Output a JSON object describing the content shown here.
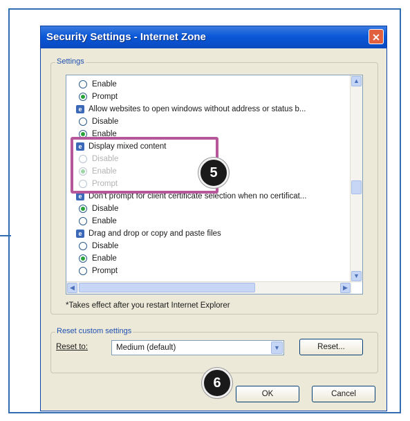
{
  "dialog": {
    "title": "Security Settings - Internet Zone",
    "close_symbol": "✕"
  },
  "settings_group": {
    "label": "Settings",
    "rows": [
      {
        "kind": "option",
        "label": "Enable",
        "checked": false,
        "disabled": false
      },
      {
        "kind": "option",
        "label": "Prompt",
        "checked": true,
        "disabled": false
      },
      {
        "kind": "category",
        "label": "Allow websites to open windows without address or status b..."
      },
      {
        "kind": "option",
        "label": "Disable",
        "checked": false,
        "disabled": false
      },
      {
        "kind": "option",
        "label": "Enable",
        "checked": true,
        "disabled": false
      },
      {
        "kind": "category",
        "label": "Display mixed content"
      },
      {
        "kind": "option",
        "label": "Disable",
        "checked": false,
        "disabled": true
      },
      {
        "kind": "option",
        "label": "Enable",
        "checked": true,
        "disabled": true
      },
      {
        "kind": "option",
        "label": "Prompt",
        "checked": false,
        "disabled": true
      },
      {
        "kind": "category",
        "label": "Don't prompt for client certificate selection when no certificat..."
      },
      {
        "kind": "option",
        "label": "Disable",
        "checked": true,
        "disabled": false
      },
      {
        "kind": "option",
        "label": "Enable",
        "checked": false,
        "disabled": false
      },
      {
        "kind": "category",
        "label": "Drag and drop or copy and paste files"
      },
      {
        "kind": "option",
        "label": "Disable",
        "checked": false,
        "disabled": false
      },
      {
        "kind": "option",
        "label": "Enable",
        "checked": true,
        "disabled": false
      },
      {
        "kind": "option",
        "label": "Prompt",
        "checked": false,
        "disabled": false
      }
    ]
  },
  "note": "*Takes effect after you restart Internet Explorer",
  "reset_group": {
    "label": "Reset custom settings",
    "reset_to_label": "Reset to:",
    "selected_level": "Medium (default)",
    "reset_button": "Reset..."
  },
  "buttons": {
    "ok": "OK",
    "cancel": "Cancel"
  },
  "callouts": {
    "step5": "5",
    "step6": "6"
  },
  "colors": {
    "title_bar": "#0b58d8",
    "callout_border": "#b5579a",
    "radio_checked": "#29a337"
  },
  "icons": {
    "category": "ie-settings-icon",
    "radio": "radio-button",
    "scroll_up": "arrow-up-icon",
    "scroll_down": "arrow-down-icon",
    "scroll_left": "arrow-left-icon",
    "scroll_right": "arrow-right-icon",
    "dropdown": "chevron-down-icon"
  }
}
